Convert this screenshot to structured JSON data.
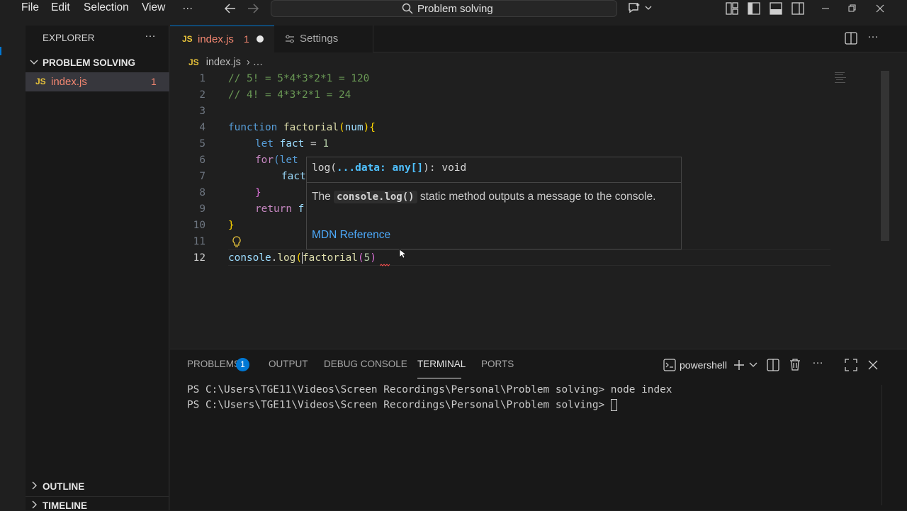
{
  "menu": {
    "file": "File",
    "edit": "Edit",
    "selection": "Selection",
    "view": "View",
    "more": "…"
  },
  "search": {
    "label": "Problem solving"
  },
  "sidebar": {
    "title": "EXPLORER",
    "more": "…",
    "folder": "PROBLEM SOLVING",
    "file": {
      "icon": "JS",
      "name": "index.js",
      "problems": "1"
    },
    "outline": "OUTLINE",
    "timeline": "TIMELINE"
  },
  "tabs": [
    {
      "icon": "JS",
      "label": "index.js",
      "problems": "1"
    },
    {
      "label": "Settings"
    }
  ],
  "breadcrumb": {
    "icon": "JS",
    "file": "index.js",
    "rest": "› …"
  },
  "code": {
    "line_numbers": [
      "1",
      "2",
      "3",
      "4",
      "5",
      "6",
      "7",
      "8",
      "9",
      "10",
      "11",
      "12"
    ],
    "l1": "// 5! = 5*4*3*2*1 = 120",
    "l2": "// 4! = 4*3*2*1 = 24",
    "l4_kw": "function",
    "l4_fn": "factorial",
    "l4_p1": "(",
    "l4_va": "num",
    "l4_p2": "){",
    "l5_kw": "let",
    "l5_va": "fact",
    "l5_op": " = ",
    "l5_nu": "1",
    "l6_kw": "for",
    "l6_rest": "(let ",
    "l7": "fact",
    "l8": "}",
    "l9_kw": "return",
    "l9_rest": " f",
    "l10": "}",
    "l12_a": "console",
    "l12_b": ".",
    "l12_fn": "log",
    "l12_c": "(",
    "l12_fn2": "factorial",
    "l12_d": "(",
    "l12_nu": "5",
    "l12_e": ")"
  },
  "hover": {
    "sig_a": "log(",
    "sig_b": "...data: ",
    "sig_c": "any[]",
    "sig_d": "): void",
    "doc_a": "The ",
    "doc_code": "console.log()",
    "doc_b": " static method outputs a message to the console.",
    "link": "MDN Reference"
  },
  "panel": {
    "tabs": {
      "problems": "PROBLEMS",
      "problems_count": "1",
      "output": "OUTPUT",
      "debug": "DEBUG CONSOLE",
      "terminal": "TERMINAL",
      "ports": "PORTS"
    },
    "shell": "powershell",
    "more": "…",
    "lines": [
      "PS C:\\Users\\TGE11\\Videos\\Screen Recordings\\Personal\\Problem solving> node index",
      "PS C:\\Users\\TGE11\\Videos\\Screen Recordings\\Personal\\Problem solving> "
    ]
  },
  "colors": {
    "accent": "#0078d4",
    "js_icon": "#e8c33a",
    "error": "#f48771",
    "link": "#4daafc"
  }
}
